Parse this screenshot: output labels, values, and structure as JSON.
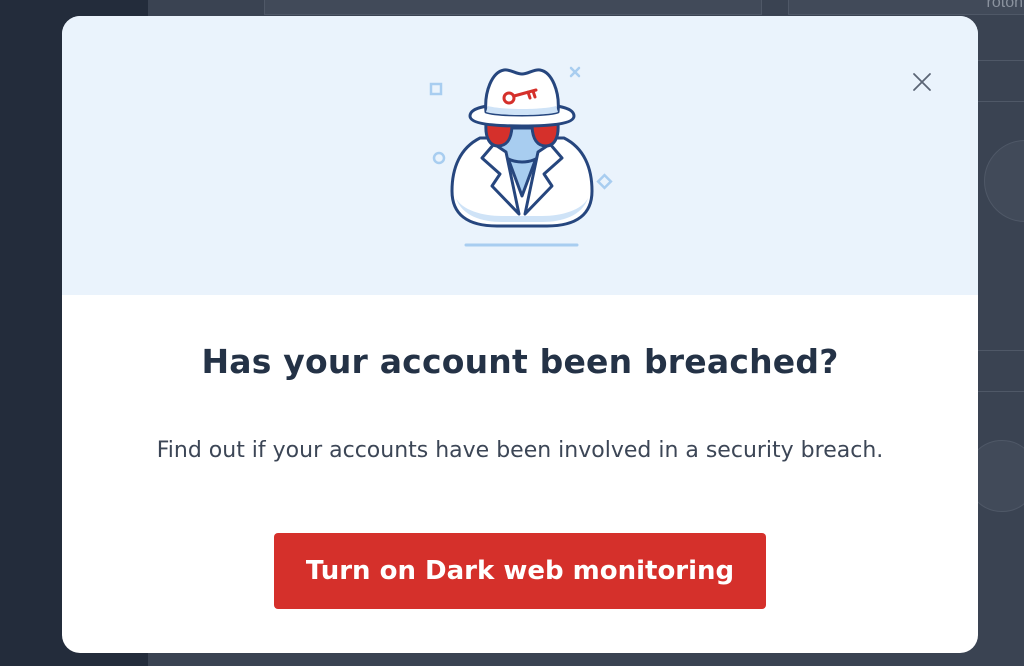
{
  "background": {
    "field_text": "roton"
  },
  "modal": {
    "illustration": "incognito-spy-with-key-icon",
    "close_icon": "close-icon",
    "title": "Has your account been breached?",
    "description": "Find out if your accounts have been involved in a security breach.",
    "cta_label": "Turn on Dark web monitoring"
  },
  "colors": {
    "hero_background": "#eaf3fc",
    "title_text": "#243246",
    "cta_background": "#d5302b",
    "accent_red": "#d5302b",
    "illustration_outline": "#26467e",
    "illustration_blue": "#a8cdf0"
  }
}
